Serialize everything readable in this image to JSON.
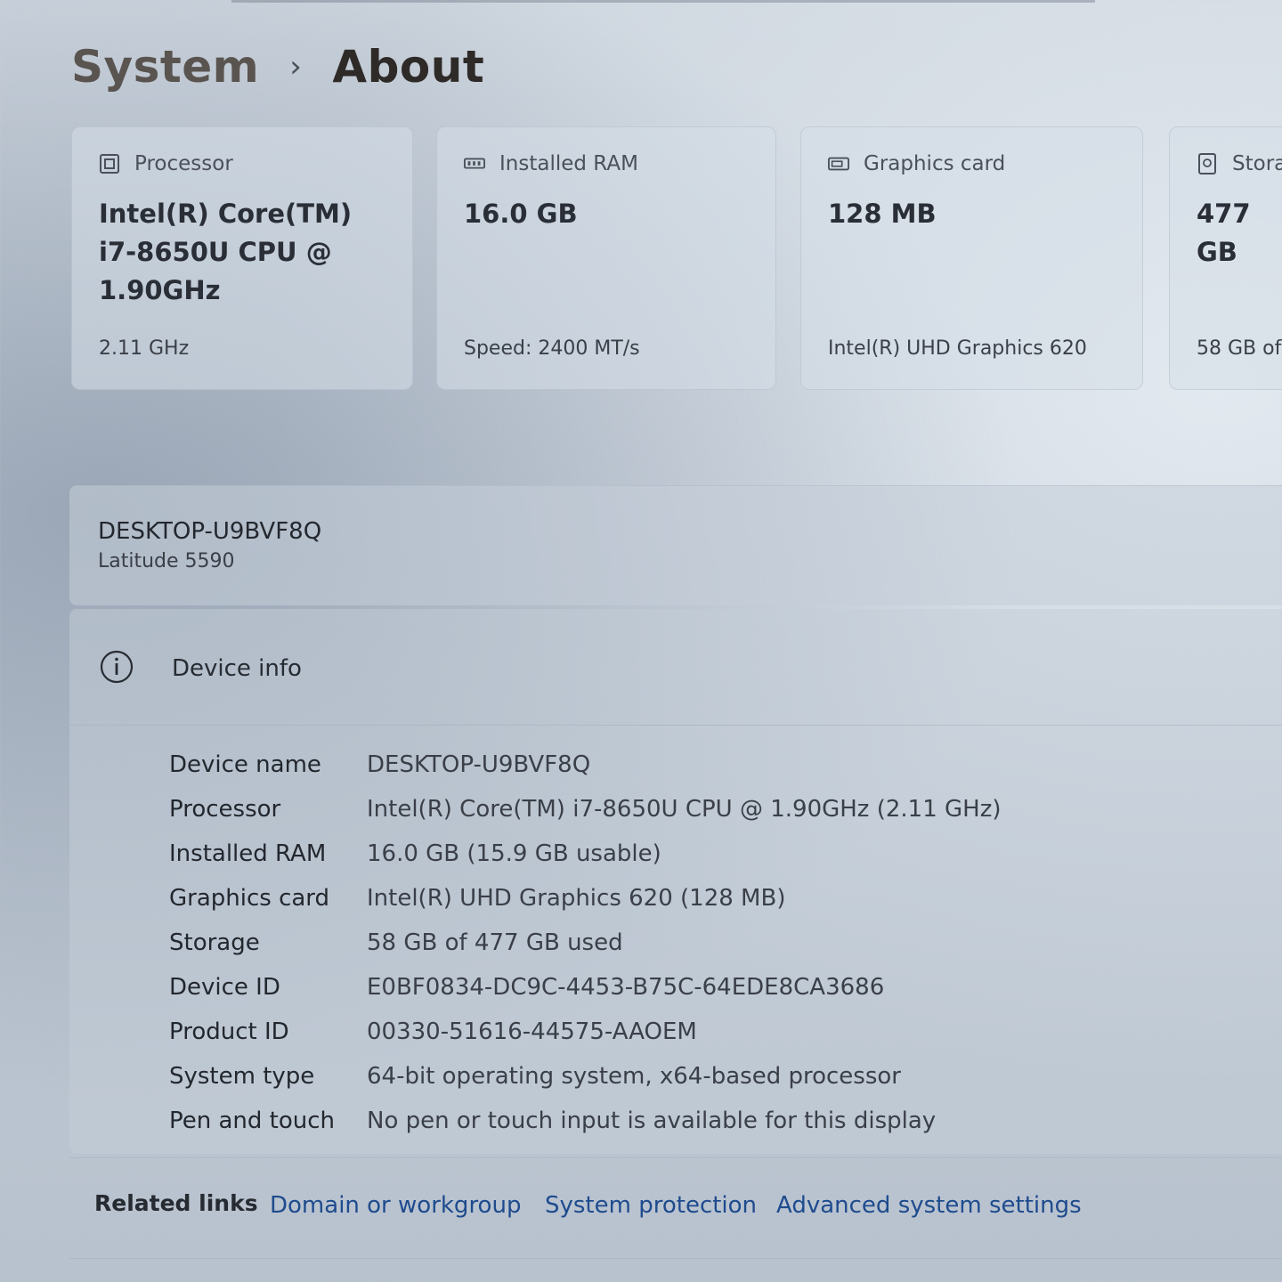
{
  "breadcrumb": {
    "parent": "System",
    "separator": "›",
    "current": "About"
  },
  "cards": [
    {
      "icon": "processor-icon",
      "label": "Processor",
      "value": "Intel(R) Core(TM)\ni7-8650U CPU @\n1.90GHz",
      "sub": "2.11 GHz"
    },
    {
      "icon": "ram-icon",
      "label": "Installed RAM",
      "value": "16.0 GB",
      "sub": "Speed: 2400 MT/s"
    },
    {
      "icon": "graphics-card-icon",
      "label": "Graphics card",
      "value": "128 MB",
      "sub": "Intel(R) UHD Graphics 620"
    },
    {
      "icon": "storage-icon",
      "label": "Stora",
      "value": "477 GB",
      "sub": "58 GB of"
    }
  ],
  "device": {
    "pc_name": "DESKTOP-U9BVF8Q",
    "model": "Latitude 5590"
  },
  "device_info": {
    "title": "Device info",
    "icon": "info-icon",
    "rows": [
      {
        "key": "Device name",
        "value": "DESKTOP-U9BVF8Q"
      },
      {
        "key": "Processor",
        "value": "Intel(R) Core(TM) i7-8650U CPU @ 1.90GHz (2.11 GHz)"
      },
      {
        "key": "Installed RAM",
        "value": "16.0 GB (15.9 GB usable)"
      },
      {
        "key": "Graphics card",
        "value": "Intel(R) UHD Graphics 620 (128 MB)"
      },
      {
        "key": "Storage",
        "value": "58 GB of 477 GB used"
      },
      {
        "key": "Device ID",
        "value": "E0BF0834-DC9C-4453-B75C-64EDE8CA3686"
      },
      {
        "key": "Product ID",
        "value": "00330-51616-44575-AAOEM"
      },
      {
        "key": "System type",
        "value": "64-bit operating system, x64-based processor"
      },
      {
        "key": "Pen and touch",
        "value": "No pen or touch input is available for this display"
      }
    ]
  },
  "related_links": {
    "label": "Related links",
    "links": [
      "Domain or workgroup",
      "System protection",
      "Advanced system settings"
    ]
  },
  "colors": {
    "link": "#1e4b8e",
    "text": "#262b33"
  }
}
